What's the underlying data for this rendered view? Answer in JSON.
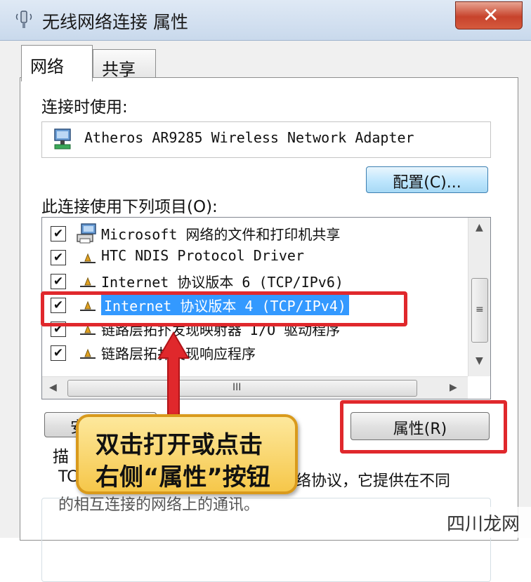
{
  "window": {
    "title": "无线网络连接 属性",
    "close_label": "✕"
  },
  "tabs": [
    {
      "label": "网络"
    },
    {
      "label": "共享"
    }
  ],
  "connect_using": {
    "label": "连接时使用:",
    "adapter": "Atheros AR9285 Wireless Network Adapter",
    "configure_button": "配置(C)..."
  },
  "items_list": {
    "label": "此连接使用下列项目(O):",
    "items": [
      {
        "label": "Microsoft 网络的文件和打印机共享",
        "checked": "✔"
      },
      {
        "label": "HTC NDIS Protocol Driver",
        "checked": "✔"
      },
      {
        "label": "Internet 协议版本 6 (TCP/IPv6)",
        "checked": "✔"
      },
      {
        "label": "Internet 协议版本 4 (TCP/IPv4)",
        "checked": "✔"
      },
      {
        "label": "链路层拓扑发现映射器 I/O 驱动程序",
        "checked": "✔"
      },
      {
        "label": "链路层拓扑发现响应程序",
        "checked": "✔"
      }
    ],
    "scroll_grip_v": "≡",
    "scroll_grip_h": "III"
  },
  "buttons": {
    "install_partial": "安",
    "properties": "属性(R)"
  },
  "description": {
    "label_partial": "描",
    "line1_start": "TC",
    "line1_end": "络协议，它提供在不同",
    "line2": "的相互连接的网络上的通讯。"
  },
  "callout": {
    "line1": "双击打开或点击",
    "line2": "右侧“属性”按钮"
  },
  "watermark": "四川龙网",
  "colors": {
    "highlight_box": "#e0282c",
    "selection": "#3399ff",
    "callout_fill": "#f6c74a"
  }
}
